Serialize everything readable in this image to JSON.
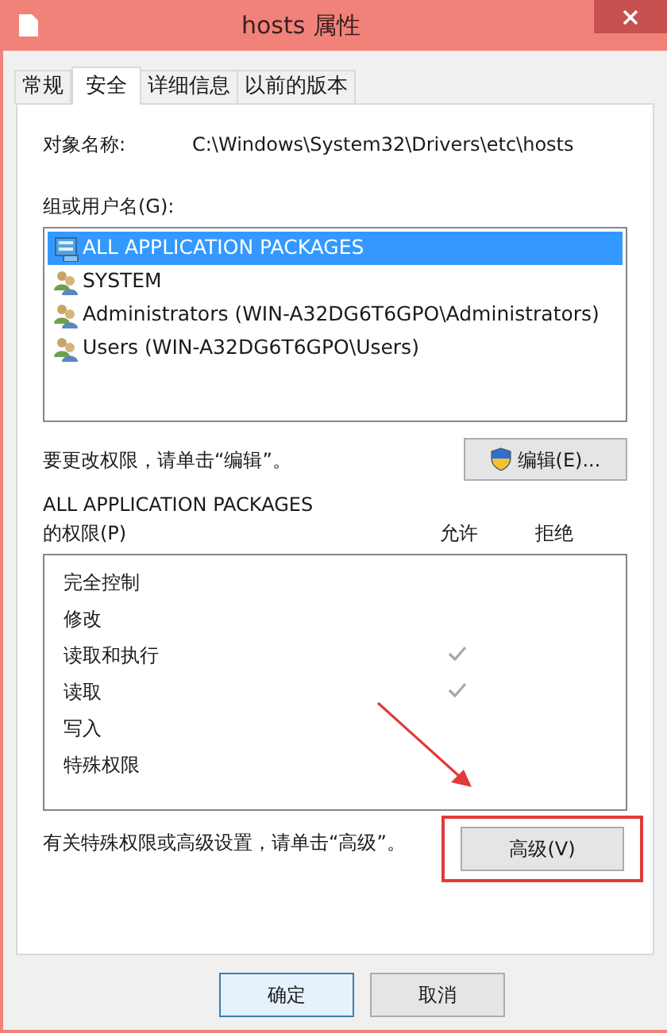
{
  "window": {
    "title": "hosts 属性"
  },
  "tabs": [
    {
      "label": "常规",
      "selected": false
    },
    {
      "label": "安全",
      "selected": true
    },
    {
      "label": "详细信息",
      "selected": false
    },
    {
      "label": "以前的版本",
      "selected": false
    }
  ],
  "object_name": {
    "label": "对象名称:",
    "value": "C:\\Windows\\System32\\Drivers\\etc\\hosts"
  },
  "groups": {
    "label": "组或用户名(G):",
    "items": [
      {
        "name": "ALL APPLICATION PACKAGES",
        "kind": "package",
        "selected": true
      },
      {
        "name": "SYSTEM",
        "kind": "users",
        "selected": false
      },
      {
        "name": "Administrators (WIN-A32DG6T6GPO\\Administrators)",
        "kind": "users",
        "selected": false
      },
      {
        "name": "Users (WIN-A32DG6T6GPO\\Users)",
        "kind": "users",
        "selected": false
      }
    ]
  },
  "edit_hint": "要更改权限，请单击“编辑”。",
  "edit_button": "编辑(E)...",
  "permissions": {
    "title": "ALL APPLICATION PACKAGES",
    "label": "的权限(P)",
    "columns": [
      "允许",
      "拒绝"
    ],
    "rows": [
      {
        "name": "完全控制",
        "allow": false,
        "deny": false
      },
      {
        "name": "修改",
        "allow": false,
        "deny": false
      },
      {
        "name": "读取和执行",
        "allow": true,
        "deny": false
      },
      {
        "name": "读取",
        "allow": true,
        "deny": false
      },
      {
        "name": "写入",
        "allow": false,
        "deny": false
      },
      {
        "name": "特殊权限",
        "allow": false,
        "deny": false
      }
    ]
  },
  "advanced_hint": "有关特殊权限或高级设置，请单击“高级”。",
  "advanced_button": "高级(V)",
  "buttons": [
    {
      "label": "确定",
      "default": true
    },
    {
      "label": "取消",
      "default": false
    }
  ]
}
